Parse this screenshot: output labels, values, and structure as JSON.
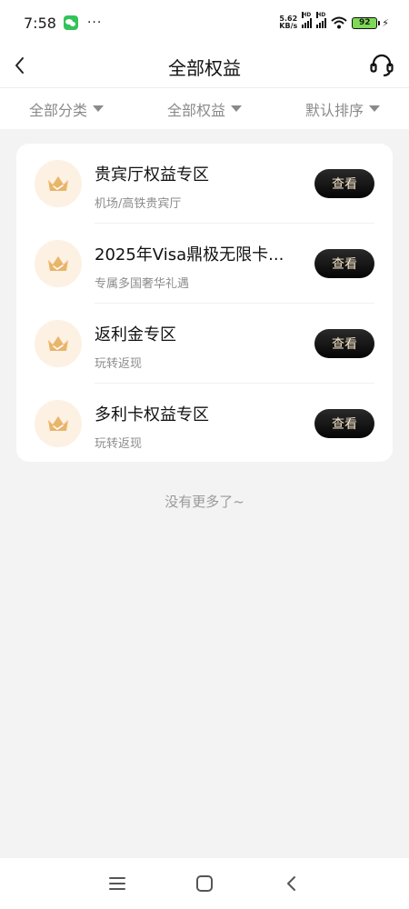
{
  "status_bar": {
    "time": "7:58",
    "net_speed_top": "5.62",
    "net_speed_bottom": "KB/s",
    "hd1": "HD",
    "hd2": "HD",
    "battery": "92",
    "dots": "···"
  },
  "header": {
    "title": "全部权益"
  },
  "filters": [
    {
      "label": "全部分类"
    },
    {
      "label": "全部权益"
    },
    {
      "label": "默认排序"
    }
  ],
  "benefits": [
    {
      "title": "贵宾厅权益专区",
      "subtitle": "机场/高铁贵宾厅",
      "button": "查看"
    },
    {
      "title": "2025年Visa鼎极无限卡...",
      "subtitle": "专属多国奢华礼遇",
      "button": "查看"
    },
    {
      "title": "返利金专区",
      "subtitle": "玩转返现",
      "button": "查看"
    },
    {
      "title": "多利卡权益专区",
      "subtitle": "玩转返现",
      "button": "查看"
    }
  ],
  "footer_text": "没有更多了~",
  "colors": {
    "crown_bg": "#fcf1e2",
    "crown": "#e9b56a",
    "button_bg": "#111111",
    "button_text": "#f7e6c9"
  },
  "icons": {
    "back": "chevron-left-icon",
    "service": "headset-icon",
    "badge": "crown-icon"
  }
}
